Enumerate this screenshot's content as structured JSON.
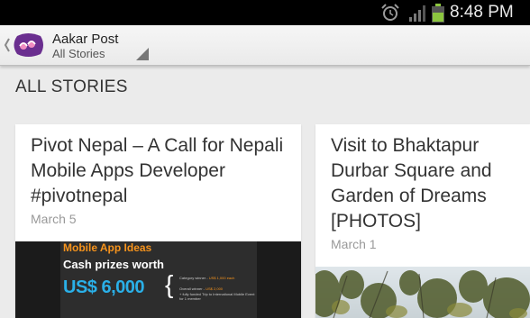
{
  "status_bar": {
    "time": "8:48 PM",
    "icons": [
      "alarm-icon",
      "signal-icon",
      "battery-icon"
    ],
    "battery_color": "#8cc63f"
  },
  "action_bar": {
    "title": "Aakar Post",
    "subtitle": "All Stories",
    "logo_text": "aP",
    "logo_color": "#6a2e8f"
  },
  "section": {
    "header": "ALL STORIES"
  },
  "stories": [
    {
      "title": "Pivot Nepal – A Call for Nepali Mobile Apps Developer #pivotnepal",
      "date": "March 5",
      "image": {
        "line1": "Mobile App Ideas",
        "line2": "Cash prizes worth",
        "amount": "US$ 6,000",
        "brace": "{",
        "fine_print": [
          {
            "text": "Category winner - ",
            "highlight": "US$ 1,000 each"
          },
          {
            "text": "Overall winner - ",
            "highlight": "US$ 2,000"
          },
          {
            "text": "+ fully funded Trip to International Mobile Event",
            "highlight": ""
          },
          {
            "text": "for 1 member",
            "highlight": ""
          }
        ],
        "accent_orange": "#f7941d",
        "accent_blue": "#2ab0e8"
      }
    },
    {
      "title": "Visit to Bhaktapur Durbar Square and Garden of Dreams [PHOTOS]",
      "date": "March 1"
    }
  ]
}
